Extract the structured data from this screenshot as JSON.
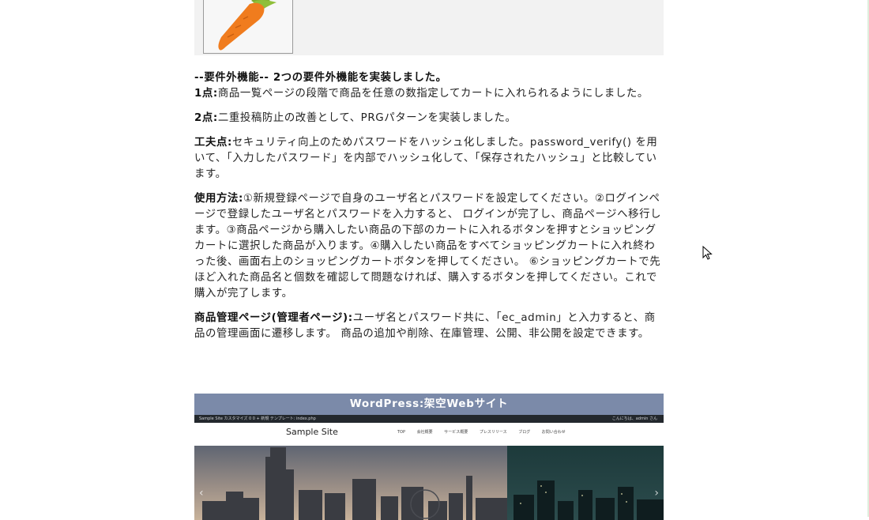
{
  "intro": {
    "heading": "--要件外機能-- 2つの要件外機能を実装しました。",
    "point1_label": "1点:",
    "point1_text": "商品一覧ページの段階で商品を任意の数指定してカートに入れられるようにしました。"
  },
  "point2": {
    "label": "2点:",
    "text": "二重投稿防止の改善として、PRGパターンを実装しました。"
  },
  "ingenuity": {
    "label": "工夫点:",
    "text": "セキュリティ向上のためパスワードをハッシュ化しました。password_verify() を用いて、「入力したパスワード」を内部でハッシュ化して、「保存されたハッシュ」と比較しています。"
  },
  "usage": {
    "label": "使用方法:",
    "text": "①新規登録ページで自身のユーザ名とパスワードを設定してください。②ログインページで登録したユーザ名とパスワードを入力すると、 ログインが完了し、商品ページへ移行します。③商品ページから購入したい商品の下部のカートに入れるボタンを押すとショッピングカートに選択した商品が入ります。④購入したい商品をすべてショッピングカートに入れ終わった後、画面右上のショッピングカートボタンを押してください。 ⑥ショッピングカートで先ほど入れた商品名と個数を確認して問題なければ、購入するボタンを押してください。これで購入が完了します。"
  },
  "admin": {
    "label": "商品管理ページ(管理者ページ):",
    "text": "ユーザ名とパスワード共に、「ec_admin」と入力すると、商品の管理画面に遷移します。 商品の追加や削除、在庫管理、公開、非公開を設定できます。"
  },
  "wordpress": {
    "title": "WordPress:架空Webサイト",
    "adminbar_items": "Sample Site   カスタマイズ   0   0   + 新規   テンプレート: index.php",
    "adminbar_greeting": "こんにちは、admin さん",
    "site_title": "Sample Site",
    "nav": [
      "TOP",
      "会社概要",
      "サービス概要",
      "プレスリリース",
      "ブログ",
      "お問い合わせ"
    ],
    "arrow_prev": "‹",
    "arrow_next": "›"
  },
  "icons": {
    "thumbnail": "carrot-icon",
    "cursor": "mouse-pointer-icon"
  },
  "colors": {
    "panel": "#f2f2f2",
    "wp_title_bar": "#7b8aa9",
    "wp_admin_bar": "#23282d",
    "carrot": "#f07c1e",
    "leaf": "#7cab2e"
  }
}
